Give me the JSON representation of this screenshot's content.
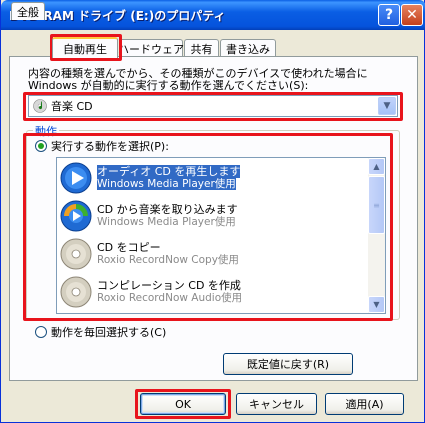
{
  "window": {
    "title": "DVD-RAM ドライブ (E:)のプロパティ",
    "help_glyph": "?",
    "close_glyph": "✕"
  },
  "tabs": [
    {
      "label": "全般",
      "active": false
    },
    {
      "label": "自動再生",
      "active": true
    },
    {
      "label": "ハードウェア",
      "active": false
    },
    {
      "label": "共有",
      "active": false
    },
    {
      "label": "書き込み",
      "active": false
    }
  ],
  "description": "内容の種類を選んでから、その種類がこのデバイスで使われた場合に Windows が自動的に実行する動作を選んでください(S):",
  "content_type": {
    "selected": "音楽 CD",
    "icon": "music-cd-icon",
    "arrow_glyph": "▼"
  },
  "actions_group": {
    "legend": "動作",
    "select_option": "実行する動作を選択(P):",
    "select_option_checked": true,
    "prompt_option": "動作を毎回選択する(C)",
    "prompt_option_checked": false,
    "items": [
      {
        "title": "オーディオ CD を再生します",
        "sub": "Windows Media Player使用",
        "icon": "media-player-icon",
        "selected": true
      },
      {
        "title": "CD から音楽を取り込みます",
        "sub": "Windows Media Player使用",
        "icon": "media-player-icon",
        "selected": false
      },
      {
        "title": "CD をコピー",
        "sub": "Roxio RecordNow Copy使用",
        "icon": "cd-disc-icon",
        "selected": false
      },
      {
        "title": "コンピレーション CD を作成",
        "sub": "Roxio RecordNow Audio使用",
        "icon": "cd-disc-icon",
        "selected": false
      }
    ],
    "scroll_up_glyph": "▲",
    "scroll_down_glyph": "▼",
    "scroll_grip_glyph": "≡"
  },
  "buttons": {
    "restore_defaults": "既定値に戻す(R)",
    "ok": "OK",
    "cancel": "キャンセル",
    "apply": "適用(A)"
  },
  "colors": {
    "highlight_box": "#e8141c",
    "selection": "#316ac5",
    "titlebar": "#0553dc"
  }
}
